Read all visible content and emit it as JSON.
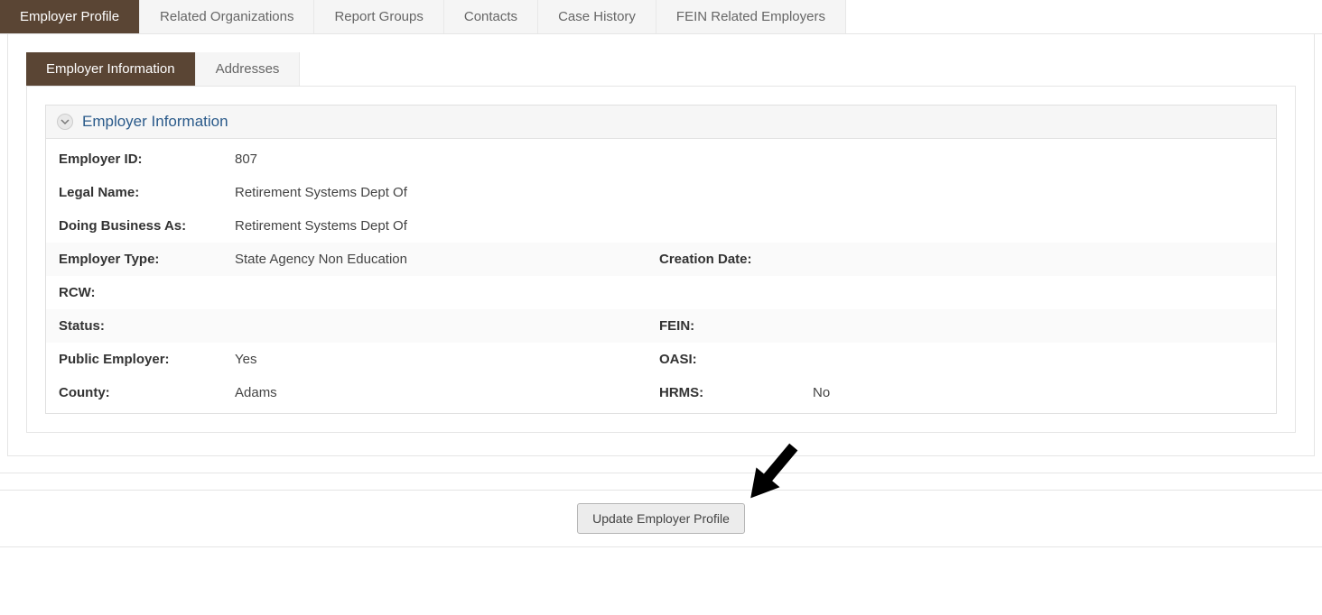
{
  "outerTabs": {
    "t0": "Employer Profile",
    "t1": "Related Organizations",
    "t2": "Report Groups",
    "t3": "Contacts",
    "t4": "Case History",
    "t5": "FEIN Related Employers"
  },
  "innerTabs": {
    "t0": "Employer Information",
    "t1": "Addresses"
  },
  "section": {
    "title": "Employer Information"
  },
  "labels": {
    "employer_id": "Employer ID:",
    "legal_name": "Legal Name:",
    "dba": "Doing Business As:",
    "employer_type": "Employer Type:",
    "creation_date": "Creation Date:",
    "rcw": "RCW:",
    "status": "Status:",
    "fein": "FEIN:",
    "public_employer": "Public Employer:",
    "oasi": "OASI:",
    "county": "County:",
    "hrms": "HRMS:"
  },
  "values": {
    "employer_id": "807",
    "legal_name": "Retirement Systems Dept Of",
    "dba": "Retirement Systems Dept Of",
    "employer_type": "State Agency Non Education",
    "creation_date": "",
    "rcw": "",
    "status": "",
    "fein": "",
    "public_employer": "Yes",
    "oasi": "",
    "county": "Adams",
    "hrms": "No"
  },
  "footer": {
    "update_button": "Update Employer Profile"
  }
}
